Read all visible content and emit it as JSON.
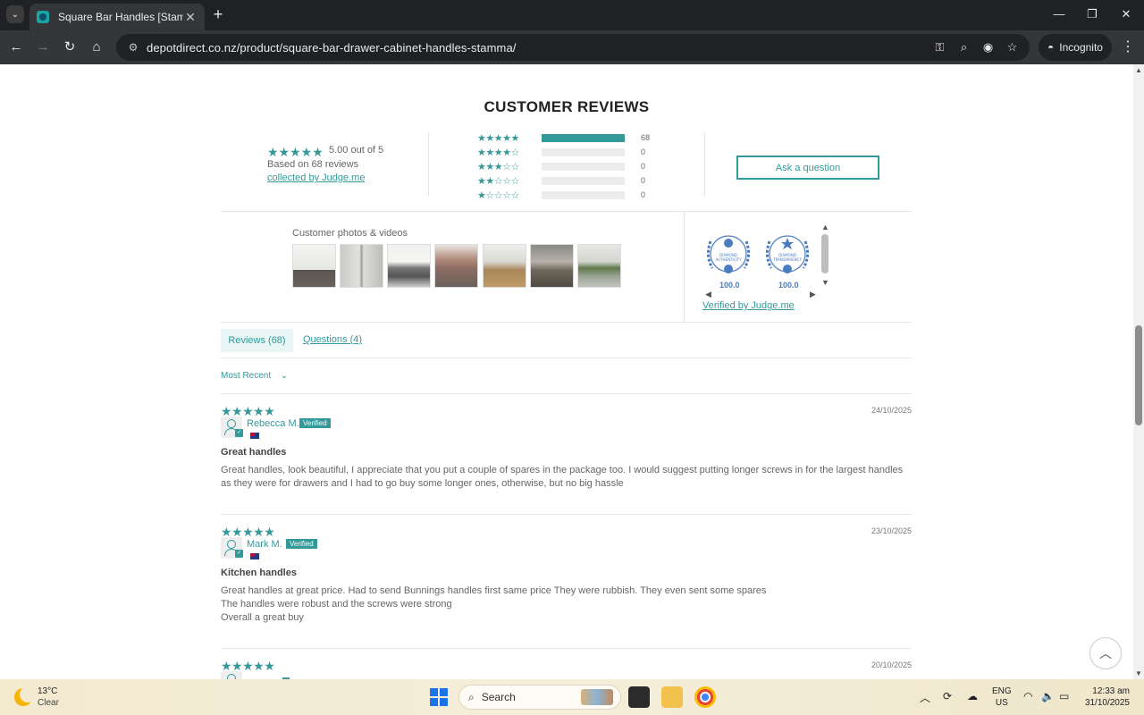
{
  "browser": {
    "tab_title": "Square Bar Handles [Stamma] |",
    "url": "depotdirect.co.nz/product/square-bar-drawer-cabinet-handles-stamma/",
    "incognito_label": "Incognito"
  },
  "reviews_widget": {
    "heading": "CUSTOMER REVIEWS",
    "average_stars": "★★★★★",
    "average_text": "5.00 out of 5",
    "based_on": "Based on 68 reviews",
    "collected_by": "collected by Judge.me",
    "histogram": [
      {
        "stars": "★★★★★",
        "count": "68",
        "fraction": 1.0
      },
      {
        "stars": "★★★★☆",
        "count": "0",
        "fraction": 0
      },
      {
        "stars": "★★★☆☆",
        "count": "0",
        "fraction": 0
      },
      {
        "stars": "★★☆☆☆",
        "count": "0",
        "fraction": 0
      },
      {
        "stars": "★☆☆☆☆",
        "count": "0",
        "fraction": 0
      }
    ],
    "ask_question": "Ask a question",
    "photos_label": "Customer photos & videos",
    "badges": [
      {
        "name": "DIAMOND AUTHENTICITY",
        "score": "100.0"
      },
      {
        "name": "DIAMOND TRANSPARENCY",
        "score": "100.0"
      }
    ],
    "verified_by": "Verified by Judge.me",
    "tabs": {
      "reviews": "Reviews (68)",
      "questions": "Questions (4)"
    },
    "sort_label": "Most Recent"
  },
  "reviews": [
    {
      "stars": "★★★★★",
      "date": "24/10/2025",
      "name": "Rebecca M.",
      "badge": "Verified",
      "title": "Great handles",
      "body": "Great handles, look beautiful, I appreciate that you put a couple of spares in the package too. I would suggest putting longer screws in for the largest handles as they were for drawers and I had to go buy some longer ones, otherwise, but no big hassle"
    },
    {
      "stars": "★★★★★",
      "date": "23/10/2025",
      "name": "Mark M.",
      "badge": "Verified",
      "title": "Kitchen handles",
      "body": "Great handles at great price. Had to send Bunnings handles first same price They were rubbish. They even sent some spares\nThe handles were robust and the screws were strong\nOverall a great buy"
    },
    {
      "stars": "★★★★★",
      "date": "20/10/2025"
    }
  ],
  "taskbar": {
    "temperature": "13°C",
    "weather": "Clear",
    "search_placeholder": "Search",
    "lang_line1": "ENG",
    "lang_line2": "US",
    "time": "12:33 am",
    "date": "31/10/2025"
  },
  "colors": {
    "accent": "#339999",
    "badge_blue": "#4a7cc0"
  }
}
